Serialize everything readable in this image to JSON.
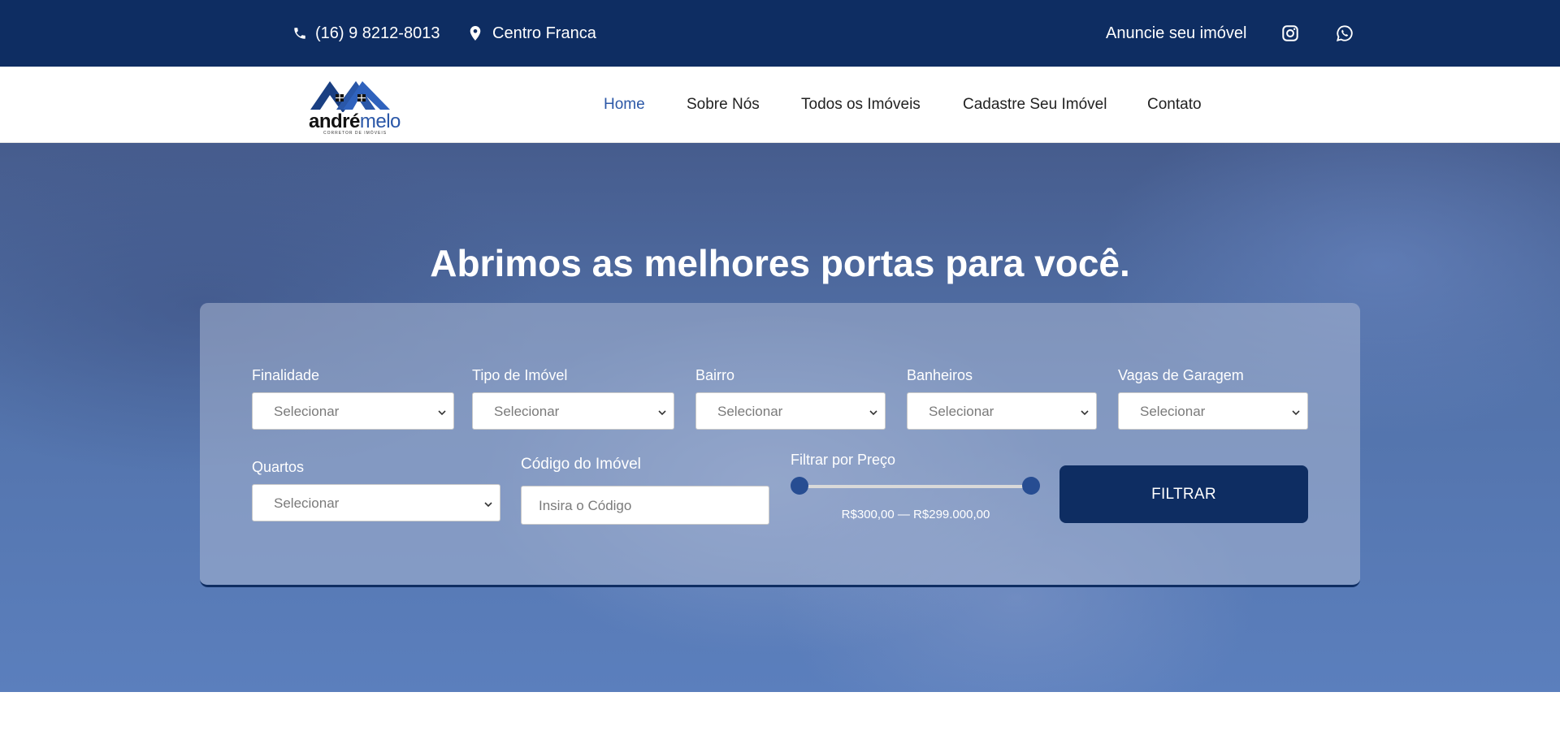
{
  "topbar": {
    "phone": "(16) 9 8212-8013",
    "location": "Centro Franca",
    "advertise": "Anuncie seu imóvel",
    "icons": [
      "phone-icon",
      "location-pin-icon",
      "instagram-icon",
      "whatsapp-icon"
    ]
  },
  "logo": {
    "word_a": "andré",
    "word_b": "melo",
    "tagline": "CORRETOR DE IMÓVEIS"
  },
  "nav": {
    "items": [
      {
        "label": "Home",
        "active": true
      },
      {
        "label": "Sobre Nós"
      },
      {
        "label": "Todos os Imóveis"
      },
      {
        "label": "Cadastre Seu Imóvel"
      },
      {
        "label": "Contato"
      }
    ]
  },
  "hero": {
    "title": "Abrimos as melhores portas para você."
  },
  "search": {
    "fields": [
      {
        "label": "Finalidade",
        "value": "Selecionar"
      },
      {
        "label": "Tipo de Imóvel",
        "value": "Selecionar"
      },
      {
        "label": "Bairro",
        "value": "Selecionar"
      },
      {
        "label": "Banheiros",
        "value": "Selecionar"
      },
      {
        "label": "Vagas de Garagem",
        "value": "Selecionar"
      },
      {
        "label": "Quartos",
        "value": "Selecionar"
      }
    ],
    "code": {
      "label": "Código do Imóvel",
      "placeholder": "Insira o Código"
    },
    "price": {
      "label": "Filtrar por Preço",
      "range_text": "R$300,00 — R$299.000,00"
    },
    "filter_button": "FILTRAR"
  },
  "colors": {
    "navy": "#0e2d62",
    "accent": "#2c58a7"
  }
}
